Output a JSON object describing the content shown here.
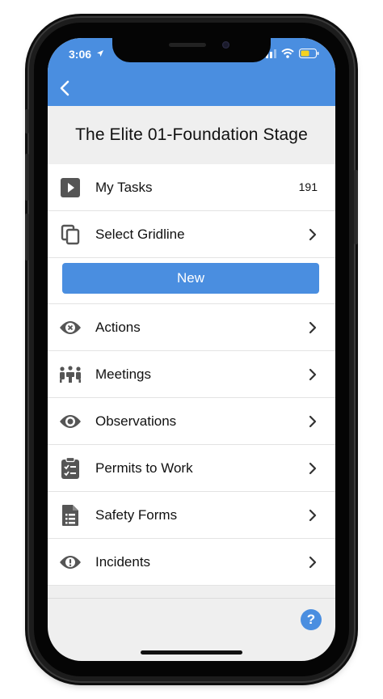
{
  "status": {
    "time": "3:06"
  },
  "nav": {
    "back_icon": "chevron-left-icon"
  },
  "page": {
    "title": "The Elite 01-Foundation Stage"
  },
  "menu": {
    "my_tasks": {
      "label": "My Tasks",
      "count": "191",
      "icon": "play-square-icon"
    },
    "select_gridline": {
      "label": "Select Gridline",
      "icon": "copy-icon"
    },
    "new_button": {
      "label": "New"
    },
    "actions": {
      "label": "Actions",
      "icon": "eye-x-icon"
    },
    "meetings": {
      "label": "Meetings",
      "icon": "meeting-people-icon"
    },
    "observations": {
      "label": "Observations",
      "icon": "eye-icon"
    },
    "permits": {
      "label": "Permits to Work",
      "icon": "clipboard-check-icon"
    },
    "safety_forms": {
      "label": "Safety Forms",
      "icon": "document-list-icon"
    },
    "incidents": {
      "label": "Incidents",
      "icon": "eye-exclamation-icon"
    }
  },
  "help": {
    "label": "?"
  },
  "colors": {
    "accent": "#4a8ee0",
    "icon": "#555555",
    "background": "#efefef"
  }
}
